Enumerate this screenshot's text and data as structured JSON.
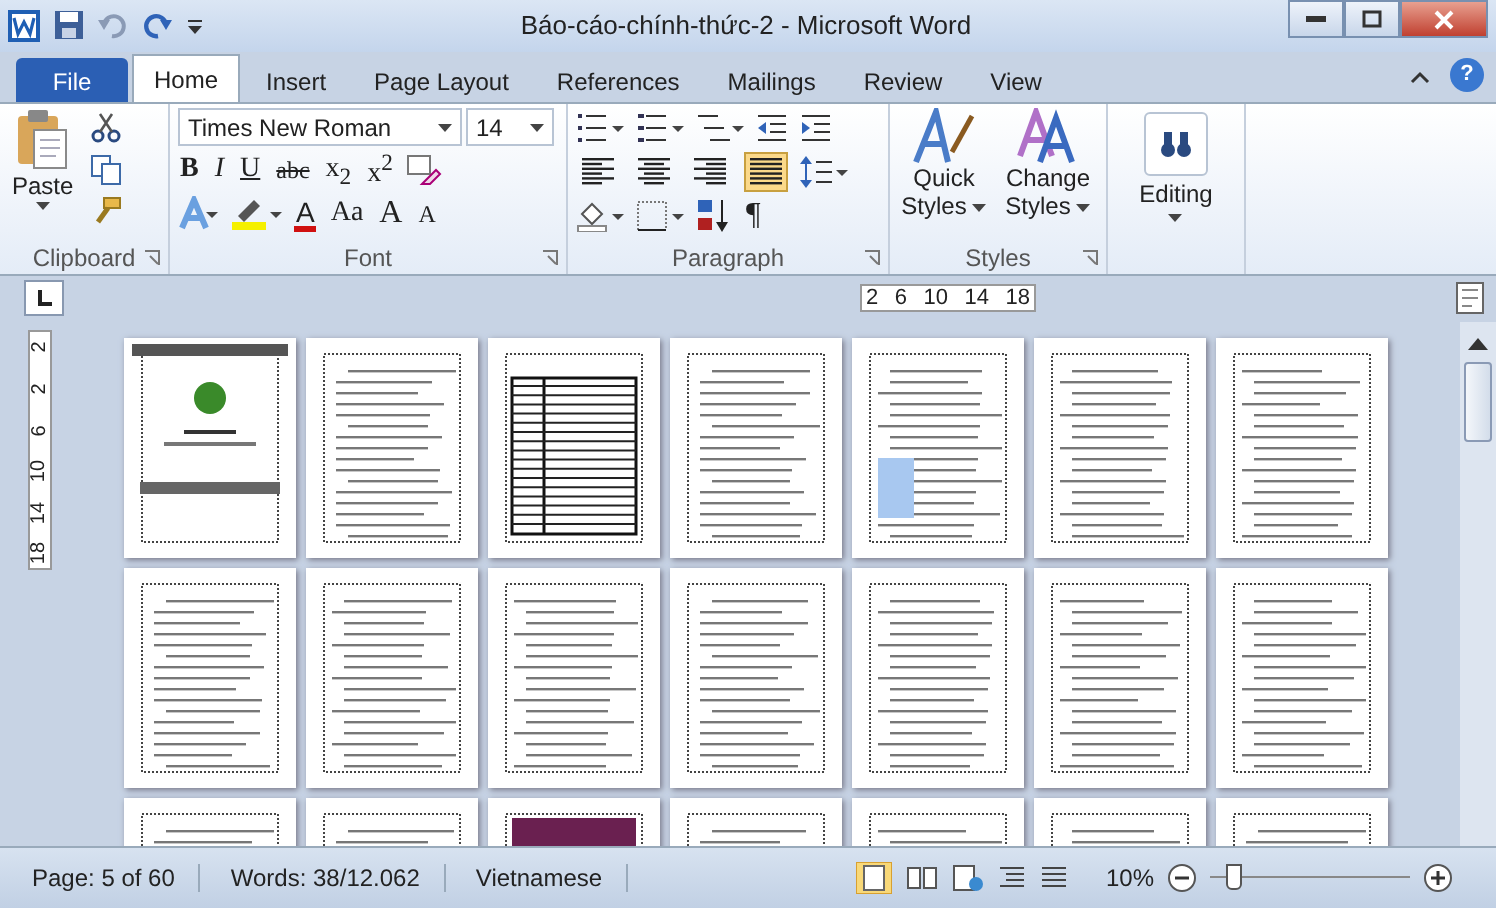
{
  "window": {
    "title": "Báo-cáo-chính-thức-2  -  Microsoft Word"
  },
  "tabs": [
    {
      "label": "File",
      "kind": "file",
      "selected": false
    },
    {
      "label": "Home",
      "kind": "tab",
      "selected": true
    },
    {
      "label": "Insert",
      "kind": "tab",
      "selected": false
    },
    {
      "label": "Page Layout",
      "kind": "tab",
      "selected": false
    },
    {
      "label": "References",
      "kind": "tab",
      "selected": false
    },
    {
      "label": "Mailings",
      "kind": "tab",
      "selected": false
    },
    {
      "label": "Review",
      "kind": "tab",
      "selected": false
    },
    {
      "label": "View",
      "kind": "tab",
      "selected": false
    }
  ],
  "clipboard": {
    "paste": "Paste",
    "label": "Clipboard"
  },
  "help": "?",
  "font": {
    "name": "Times New Roman",
    "size": "14",
    "format_buttons": [
      "B",
      "I",
      "U",
      "abc",
      "x$_{2}$",
      "x$^{2}$"
    ],
    "font_color": "A",
    "case_button": "Aa",
    "grow": "A",
    "shrink": "A",
    "label": "Font"
  },
  "paragraph": {
    "alignment": [
      {
        "selected": false
      },
      {
        "selected": false
      },
      {
        "selected": false
      },
      {
        "selected": true
      }
    ],
    "pilcrow": "¶",
    "label": "Paragraph"
  },
  "styles": {
    "quick": [
      "Quick",
      "Styles"
    ],
    "change": [
      "Change",
      "Styles"
    ],
    "label": "Styles"
  },
  "editing": {
    "label": "Editing"
  },
  "ruler": {
    "horizontal": [
      "2",
      "6",
      "10",
      "14",
      "18"
    ],
    "vertical": [
      "2",
      "2",
      "6",
      "10",
      "14",
      "18"
    ]
  },
  "pages": [
    {
      "kind": "cover"
    },
    {
      "kind": "text"
    },
    {
      "kind": "table"
    },
    {
      "kind": "text"
    },
    {
      "kind": "list"
    },
    {
      "kind": "list"
    },
    {
      "kind": "list"
    },
    {
      "kind": "text"
    },
    {
      "kind": "list"
    },
    {
      "kind": "list"
    },
    {
      "kind": "text"
    },
    {
      "kind": "list"
    },
    {
      "kind": "list"
    },
    {
      "kind": "list"
    },
    {
      "kind": "text"
    },
    {
      "kind": "text"
    },
    {
      "kind": "image"
    },
    {
      "kind": "text"
    },
    {
      "kind": "list"
    },
    {
      "kind": "list"
    },
    {
      "kind": "text"
    }
  ],
  "status_bar": {
    "items": [
      "Page: 5 of 60",
      "Words: 38/12.062",
      "Vietnamese"
    ],
    "zoom": "10%",
    "zoom_slider": {
      "level": 0.08
    }
  }
}
